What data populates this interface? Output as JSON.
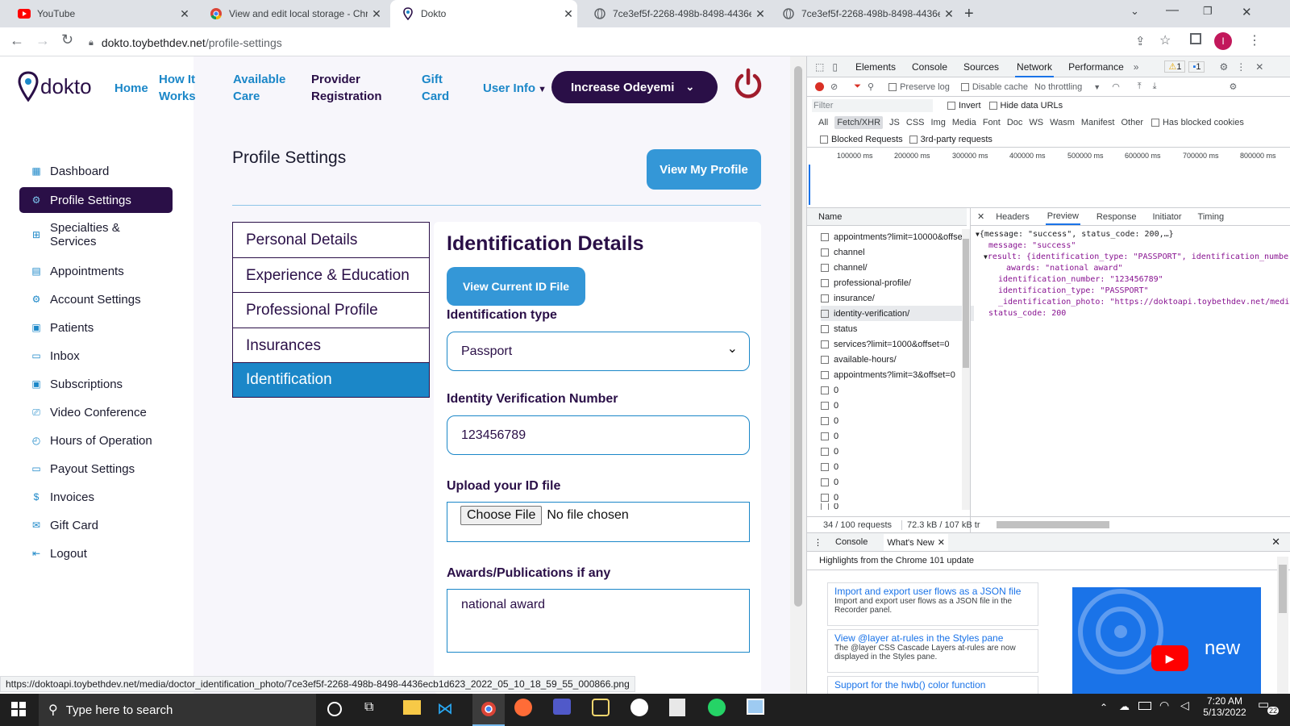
{
  "browser": {
    "tabs": [
      {
        "title": "YouTube",
        "icon": "youtube-icon"
      },
      {
        "title": "View and edit local storage - Chr",
        "icon": "chrome-icon"
      },
      {
        "title": "Dokto",
        "icon": "dokto-pin-icon"
      },
      {
        "title": "7ce3ef5f-2268-498b-8498-4436e",
        "icon": "globe-icon"
      },
      {
        "title": "7ce3ef5f-2268-498b-8498-4436e",
        "icon": "globe-icon"
      }
    ],
    "url_host": "dokto.toybethdev.net",
    "url_path": "/profile-settings",
    "profile_initial": "I",
    "status_url": "https://doktoapi.toybethdev.net/media/doctor_identification_photo/7ce3ef5f-2268-498b-8498-4436ecb1d623_2022_05_10_18_59_55_000866.png"
  },
  "site": {
    "logo": "dokto",
    "nav": {
      "home": "Home",
      "how_it_works_1": "How It",
      "how_it_works_2": "Works",
      "available_1": "Available",
      "available_2": "Care",
      "provider_1": "Provider",
      "provider_2": "Registration",
      "gift_1": "Gift",
      "gift_2": "Card",
      "user_info": "User Info"
    },
    "user_button": "Increase Odeyemi",
    "sidebar": [
      {
        "label": "Dashboard",
        "icon": "grid-icon"
      },
      {
        "label": "Profile Settings",
        "icon": "gear-icon"
      },
      {
        "label": "Specialties &",
        "label2": "Services",
        "icon": "plus-box-icon"
      },
      {
        "label": "Appointments",
        "icon": "calendar-icon"
      },
      {
        "label": "Account Settings",
        "icon": "settings-icon"
      },
      {
        "label": "Patients",
        "icon": "patients-icon"
      },
      {
        "label": "Inbox",
        "icon": "chat-icon"
      },
      {
        "label": "Subscriptions",
        "icon": "subscriptions-icon"
      },
      {
        "label": "Video Conference",
        "icon": "video-icon"
      },
      {
        "label": "Hours of Operation",
        "icon": "clock-icon"
      },
      {
        "label": "Payout Settings",
        "icon": "card-icon"
      },
      {
        "label": "Invoices",
        "icon": "invoice-icon"
      },
      {
        "label": "Gift Card",
        "icon": "gift-icon"
      },
      {
        "label": "Logout",
        "icon": "logout-icon"
      }
    ],
    "page_title": "Profile Settings",
    "view_profile": "View My Profile",
    "section_tabs": [
      "Personal Details",
      "Experience & Education",
      "Professional Profile",
      "Insurances",
      "Identification"
    ],
    "form": {
      "heading": "Identification Details",
      "view_id_button": "View Current ID File",
      "id_type_label": "Identification type",
      "id_type_value": "Passport",
      "id_number_label": "Identity Verification Number",
      "id_number_value": "123456789",
      "upload_label": "Upload your ID file",
      "choose_file": "Choose File",
      "no_file": "No file chosen",
      "awards_label": "Awards/Publications if any",
      "awards_value": "national award"
    }
  },
  "devtools": {
    "tabs": [
      "Elements",
      "Console",
      "Sources",
      "Network",
      "Performance"
    ],
    "warnings": "1",
    "messages": "1",
    "preserve_log": "Preserve log",
    "disable_cache": "Disable cache",
    "throttling": "No throttling",
    "filter_placeholder": "Filter",
    "invert": "Invert",
    "hide_data_urls": "Hide data URLs",
    "types": [
      "All",
      "Fetch/XHR",
      "JS",
      "CSS",
      "Img",
      "Media",
      "Font",
      "Doc",
      "WS",
      "Wasm",
      "Manifest",
      "Other"
    ],
    "has_blocked_cookies": "Has blocked cookies",
    "blocked_requests": "Blocked Requests",
    "third_party": "3rd-party requests",
    "timeline": [
      "100000 ms",
      "200000 ms",
      "300000 ms",
      "400000 ms",
      "500000 ms",
      "600000 ms",
      "700000 ms",
      "800000 ms"
    ],
    "name_header": "Name",
    "requests": [
      "appointments?limit=10000&offse",
      "channel",
      "channel/",
      "professional-profile/",
      "insurance/",
      "identity-verification/",
      "status",
      "services?limit=1000&offset=0",
      "available-hours/",
      "appointments?limit=3&offset=0",
      "0",
      "0",
      "0",
      "0",
      "0",
      "0",
      "0",
      "0",
      "0"
    ],
    "detail_tabs": [
      "Headers",
      "Preview",
      "Response",
      "Initiator",
      "Timing"
    ],
    "preview": [
      "{message: \"success\", status_code: 200,…}",
      "message: \"success\"",
      "result: {identification_type: \"PASSPORT\", identification_numbe",
      "awards: \"national award\"",
      "identification_number: \"123456789\"",
      "identification_type: \"PASSPORT\"",
      "_identification_photo: \"https://doktoapi.toybethdev.net/medi",
      "status_code: 200"
    ],
    "summary": "34 / 100 requests",
    "transferred": "72.3 kB / 107 kB tr",
    "drawer_tabs": [
      "Console",
      "What's New"
    ],
    "whats_new_title": "Highlights from the Chrome 101 update",
    "cards": [
      {
        "title": "Import and export user flows as a JSON file",
        "body": "Import and export user flows as a JSON file in the Recorder panel."
      },
      {
        "title": "View @layer at-rules in the Styles pane",
        "body": "The @layer CSS Cascade Layers at-rules are now displayed in the Styles pane."
      },
      {
        "title": "Support for the hwb() color function",
        "body": ""
      }
    ],
    "video_text": "new"
  },
  "taskbar": {
    "search": "Type here to search",
    "time": "7:20 AM",
    "date": "5/13/2022",
    "notifications": "22"
  }
}
